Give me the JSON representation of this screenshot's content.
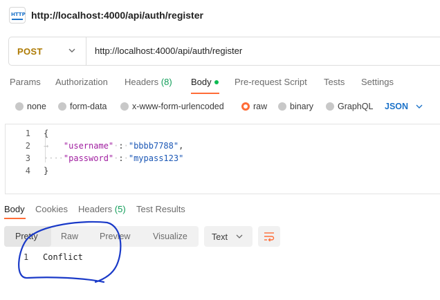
{
  "window": {
    "title": "http://localhost:4000/api/auth/register",
    "icon": "http-icon",
    "icon_text": "HTTP"
  },
  "request": {
    "method": "POST",
    "url": "http://localhost:4000/api/auth/register",
    "method_color": "#ad7a03"
  },
  "request_tabs": [
    {
      "label": "Params"
    },
    {
      "label": "Authorization"
    },
    {
      "label": "Headers",
      "count": "(8)"
    },
    {
      "label": "Body",
      "active": true
    },
    {
      "label": "Pre-request Script"
    },
    {
      "label": "Tests"
    },
    {
      "label": "Settings"
    }
  ],
  "body_types": [
    {
      "label": "none"
    },
    {
      "label": "form-data"
    },
    {
      "label": "x-www-form-urlencoded"
    },
    {
      "label": "raw",
      "selected": true
    },
    {
      "label": "binary"
    },
    {
      "label": "GraphQL"
    }
  ],
  "raw_format": "JSON",
  "editor": {
    "line_numbers": [
      "1",
      "2",
      "3",
      "4"
    ],
    "open_brace": "{",
    "close_brace": "}",
    "fields": [
      {
        "key": "\"username\"",
        "value": "\"bbbb7788\"",
        "trailing": ","
      },
      {
        "key": "\"password\"",
        "value": "\"mypass123\"",
        "trailing": ""
      }
    ]
  },
  "response_tabs": [
    {
      "label": "Body",
      "active": true
    },
    {
      "label": "Cookies"
    },
    {
      "label": "Headers",
      "count": "(5)"
    },
    {
      "label": "Test Results"
    }
  ],
  "response_view": {
    "modes": [
      "Pretty",
      "Raw",
      "Preview",
      "Visualize"
    ],
    "active_mode": "Pretty",
    "format": "Text",
    "wrap_icon": "wrap-lines-icon"
  },
  "response_body": {
    "line_number": "1",
    "text": "Conflict"
  },
  "colors": {
    "accent": "#ff6c37",
    "link_blue": "#1d73c9",
    "count_green": "#0f9d58",
    "annotation": "#1a3ac8"
  }
}
